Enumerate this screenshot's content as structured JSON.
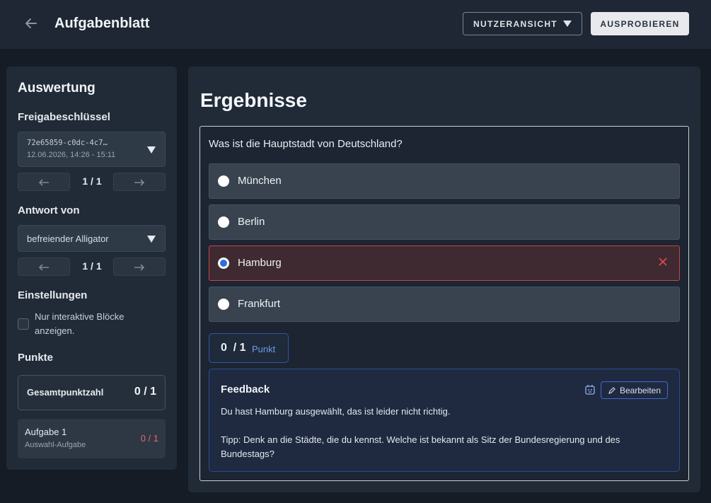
{
  "header": {
    "title": "Aufgabenblatt",
    "user_view_label": "NUTZERANSICHT",
    "try_label": "AUSPROBIEREN"
  },
  "sidebar": {
    "title": "Auswertung",
    "share_key": {
      "label": "Freigabeschlüssel",
      "key_text": "72e65859-c0dc-4c7…",
      "date_text": "12.06.2026, 14:26 - 15:11",
      "pager": "1 / 1"
    },
    "answer_from": {
      "label": "Antwort von",
      "value": "befreiender Alligator",
      "pager": "1 / 1"
    },
    "settings": {
      "label": "Einstellungen",
      "checkbox_label": "Nur interaktive Blöcke anzeigen.",
      "checked": false
    },
    "points": {
      "label": "Punkte",
      "total_label": "Gesamtpunktzahl",
      "total_value": "0 / 1",
      "tasks": [
        {
          "name": "Aufgabe 1",
          "type": "Auswahl-Aufgabe",
          "score": "0 / 1"
        }
      ]
    }
  },
  "main": {
    "title": "Ergebnisse",
    "question": "Was ist die Hauptstadt von Deutschland?",
    "options": [
      {
        "label": "München",
        "selected": false,
        "wrong": false
      },
      {
        "label": "Berlin",
        "selected": false,
        "wrong": false
      },
      {
        "label": "Hamburg",
        "selected": true,
        "wrong": true
      },
      {
        "label": "Frankfurt",
        "selected": false,
        "wrong": false
      }
    ],
    "score": {
      "value": "0  / 1",
      "unit": "Punkt"
    },
    "feedback": {
      "title": "Feedback",
      "edit_label": "Bearbeiten",
      "text1": "Du hast Hamburg ausgewählt, das ist leider nicht richtig.",
      "text2": "Tipp: Denk an die Städte, die du kennst. Welche ist bekannt als Sitz der Bundesregierung und des Bundestags?"
    }
  },
  "colors": {
    "accent": "#2b6fe0",
    "error": "#e24b4b",
    "background": "#151c26",
    "panel": "#212b37"
  }
}
